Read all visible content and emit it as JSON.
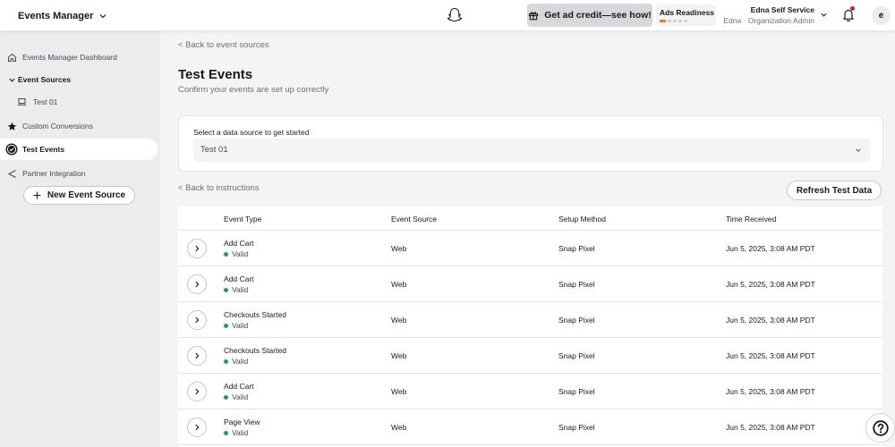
{
  "header": {
    "app_name": "Events Manager",
    "promo_label": "Get ad credit—see how!",
    "ads_readiness_label": "Ads Readiness",
    "user_name": "Edna Self Service",
    "user_role": "Edna · Organization Admin",
    "avatar_initial": "e"
  },
  "sidebar": {
    "items": [
      {
        "label": "Events Manager Dashboard",
        "icon": "home-icon"
      },
      {
        "label": "Event Sources",
        "icon": "chevron-down-icon"
      },
      {
        "label": "Test 01",
        "icon": "laptop-icon"
      },
      {
        "label": "Custom Conversions",
        "icon": "star-icon"
      },
      {
        "label": "Test Events",
        "icon": "check-circle-icon"
      },
      {
        "label": "Partner Integration",
        "icon": "share-icon"
      }
    ],
    "new_source_label": "New Event Source"
  },
  "main": {
    "back_to_sources": "< Back to event sources",
    "title": "Test Events",
    "subtitle": "Confirm your events are set up correctly",
    "select_label": "Select a data source to get started",
    "select_value": "Test 01",
    "back_to_instructions": "< Back to instructions",
    "refresh_label": "Refresh Test Data"
  },
  "table": {
    "columns": [
      "Event Type",
      "Event Source",
      "Setup Method",
      "Time Received"
    ],
    "rows": [
      {
        "event": "Add Cart",
        "status": "Valid",
        "source": "Web",
        "method": "Snap Pixel",
        "time": "Jun 5, 2025, 3:08 AM PDT"
      },
      {
        "event": "Add Cart",
        "status": "Valid",
        "source": "Web",
        "method": "Snap Pixel",
        "time": "Jun 5, 2025, 3:08 AM PDT"
      },
      {
        "event": "Checkouts Started",
        "status": "Valid",
        "source": "Web",
        "method": "Snap Pixel",
        "time": "Jun 5, 2025, 3:08 AM PDT"
      },
      {
        "event": "Checkouts Started",
        "status": "Valid",
        "source": "Web",
        "method": "Snap Pixel",
        "time": "Jun 5, 2025, 3:08 AM PDT"
      },
      {
        "event": "Add Cart",
        "status": "Valid",
        "source": "Web",
        "method": "Snap Pixel",
        "time": "Jun 5, 2025, 3:08 AM PDT"
      },
      {
        "event": "Page View",
        "status": "Valid",
        "source": "Web",
        "method": "Snap Pixel",
        "time": "Jun 5, 2025, 3:08 AM PDT"
      }
    ]
  },
  "colors": {
    "valid_dot": "#1f9d55",
    "notification_dot": "#e1143c",
    "readiness_segment": "#f47a1f",
    "readiness_track": "#d0d2d6",
    "sidebar_bg": "#ececef"
  }
}
